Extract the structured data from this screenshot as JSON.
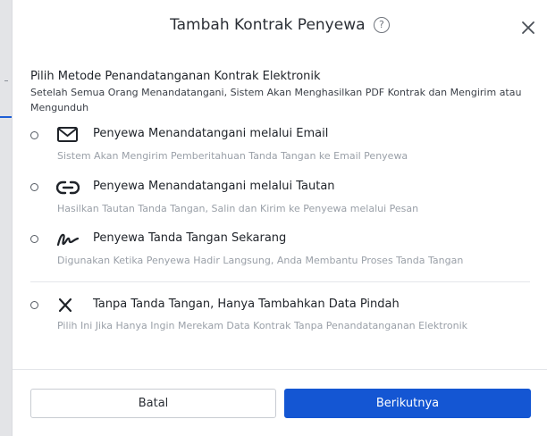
{
  "modal": {
    "title": "Tambah Kontrak Penyewa",
    "help_symbol": "?",
    "heading": "Pilih Metode Penandatanganan Kontrak Elektronik",
    "subheading": "Setelah Semua Orang Menandatangani, Sistem Akan Menghasilkan PDF Kontrak dan Mengirim atau Mengunduh",
    "options": [
      {
        "label": "Penyewa Menandatangani melalui Email",
        "description": "Sistem Akan Mengirim Pemberitahuan Tanda Tangan ke Email Penyewa",
        "icon": "envelope-icon"
      },
      {
        "label": "Penyewa Menandatangani melalui Tautan",
        "description": "Hasilkan Tautan Tanda Tangan, Salin dan Kirim ke Penyewa melalui Pesan",
        "icon": "link-icon"
      },
      {
        "label": "Penyewa Tanda Tangan Sekarang",
        "description": "Digunakan Ketika Penyewa Hadir Langsung, Anda Membantu Proses Tanda Tangan",
        "icon": "signature-icon"
      },
      {
        "label": "Tanpa Tanda Tangan, Hanya Tambahkan Data Pindah",
        "description": "Pilih Ini Jika Hanya Ingin Merekam Data Kontrak Tanpa Penandatanganan Elektronik",
        "icon": "x-icon"
      }
    ],
    "buttons": {
      "cancel": "Batal",
      "next": "Berikutnya"
    }
  },
  "colors": {
    "primary": "#1456d3",
    "muted_text": "#9aa0a8"
  }
}
